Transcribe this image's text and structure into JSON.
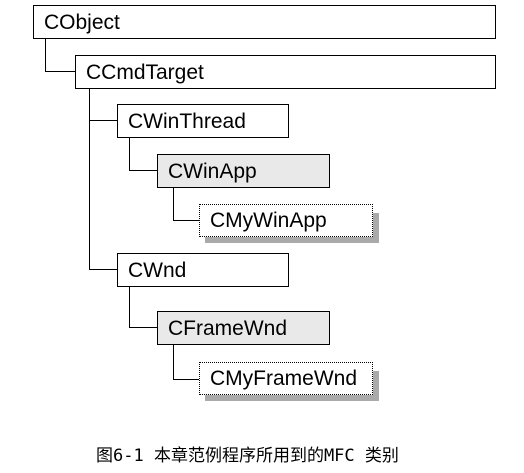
{
  "diagram": {
    "nodes": [
      {
        "key": "cobject",
        "label": "CObject",
        "style": "plain"
      },
      {
        "key": "ccmdtarget",
        "label": "CCmdTarget",
        "style": "plain"
      },
      {
        "key": "cwinthread",
        "label": "CWinThread",
        "style": "plain"
      },
      {
        "key": "cwinapp",
        "label": "CWinApp",
        "style": "mfc-app"
      },
      {
        "key": "cmywinapp",
        "label": "CMyWinApp",
        "style": "user"
      },
      {
        "key": "cwnd",
        "label": "CWnd",
        "style": "plain"
      },
      {
        "key": "cframewnd",
        "label": "CFrameWnd",
        "style": "mfc-app"
      },
      {
        "key": "cmyframewnd",
        "label": "CMyFrameWnd",
        "style": "user"
      }
    ],
    "edges": [
      {
        "from": "cobject",
        "to": "ccmdtarget"
      },
      {
        "from": "ccmdtarget",
        "to": "cwinthread"
      },
      {
        "from": "ccmdtarget",
        "to": "cwnd"
      },
      {
        "from": "cwinthread",
        "to": "cwinapp"
      },
      {
        "from": "cwinapp",
        "to": "cmywinapp"
      },
      {
        "from": "cwnd",
        "to": "cframewnd"
      },
      {
        "from": "cframewnd",
        "to": "cmyframewnd"
      }
    ]
  },
  "caption": "图6-1 本章范例程序所用到的MFC 类别"
}
